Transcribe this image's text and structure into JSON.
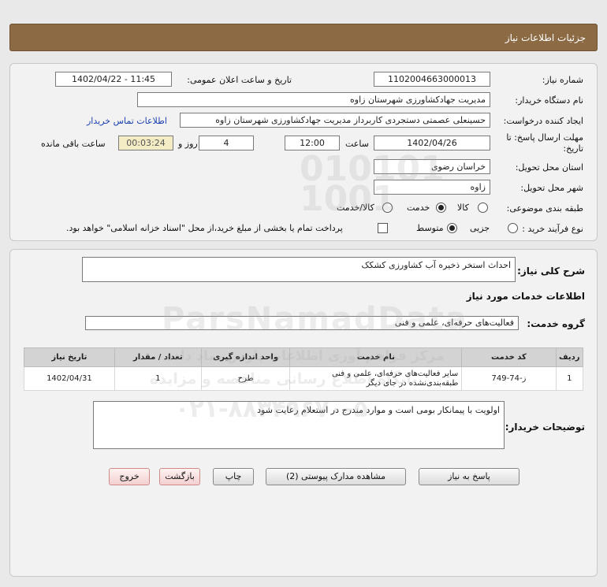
{
  "page_title": "جزئیات اطلاعات نیاز",
  "fields": {
    "need_number_label": "شماره نیاز:",
    "need_number": "1102004663000013",
    "announce_label": "تاریخ و ساعت اعلان عمومی:",
    "announce_value": "1402/04/22 - 11:45",
    "buyer_org_label": "نام دستگاه خریدار:",
    "buyer_org": "مدیریت جهادکشاورزی شهرستان زاوه",
    "creator_label": "ایجاد کننده درخواست:",
    "creator": "حسینعلی  عصمتی دستجردی کاربرداز مدیریت جهادکشاورزی شهرستان زاوه",
    "contact_link": "اطلاعات تماس خریدار",
    "deadline_label_1": "مهلت ارسال پاسخ: تا",
    "deadline_label_2": "تاریخ:",
    "deadline_date": "1402/04/26",
    "time_label": "ساعت",
    "deadline_time": "12:00",
    "days_value": "4",
    "days_label": "روز و",
    "remaining_time": "00:03:24",
    "remaining_label": "ساعت باقی مانده",
    "province_label": "استان محل تحویل:",
    "province": "خراسان رضوی",
    "city_label": "شهر محل تحویل:",
    "city": "زاوه",
    "category_label": "طبقه بندی موضوعی:",
    "category_options": [
      "کالا",
      "خدمت",
      "کالا/خدمت"
    ],
    "category_selected": "خدمت",
    "process_label": "نوع فرآیند خرید :",
    "process_options": [
      "جزیی",
      "متوسط"
    ],
    "process_selected": "متوسط",
    "payment_note": "پرداخت تمام یا بخشی از مبلغ خرید،از محل \"اسناد خزانه اسلامی\" خواهد بود."
  },
  "summary": {
    "general_desc_label": "شرح کلی نیاز:",
    "general_desc": "احداث استخر ذخیره آب کشاورزی کشکک",
    "services_title": "اطلاعات خدمات مورد نیاز",
    "service_group_label": "گروه خدمت:",
    "service_group": "فعالیت‌های حرفه‌ای، علمی و فنی"
  },
  "table": {
    "headers": [
      "ردیف",
      "کد خدمت",
      "نام خدمت",
      "واحد اندازه گیری",
      "تعداد / مقدار",
      "تاریخ نیاز"
    ],
    "rows": [
      [
        "1",
        "ز-74-749",
        "سایر فعالیت‌های حرفه‌ای، علمی و فنی طبقه‌بندی‌نشده در جای دیگر",
        "طرح",
        "1",
        "1402/04/31"
      ]
    ]
  },
  "buyer_notes_label": "توضیحات خریدار:",
  "buyer_notes": "اولویت با پیمانکار بومی است و موارد مندرج در استعلام رعایت شود",
  "buttons": {
    "reply": "پاسخ به نیاز",
    "view_docs": "مشاهده مدارک پیوستی (2)",
    "print": "چاپ",
    "back": "بازگشت",
    "exit": "خروج"
  },
  "watermark": {
    "brand": "ParsNamadData",
    "phone": "۰۲۱-۸۸۳۴۹۶۷۰-۵",
    "line1": "مرکز فراهم آوری اطلاعات پارس نماد داده",
    "line2": "پایگاه اطلاع رسانی مناقصه و مزایده"
  },
  "colors": {
    "header_bg": "#8b6a44",
    "timer_bg": "#f3ecc4",
    "link": "#1a3fb0",
    "exit_btn": "#f3cfcf"
  }
}
